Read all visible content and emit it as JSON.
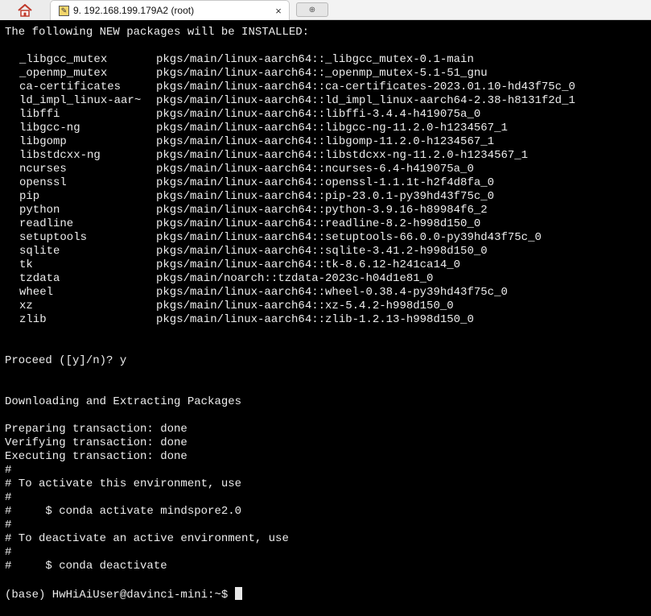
{
  "window": {
    "home_icon": "home-icon",
    "tab_icon": "terminal-icon",
    "tab_title": "9. 192.168.199.179A2 (root)",
    "tab_close": "×",
    "new_tab_symbol": "⊕"
  },
  "terminal": {
    "header": "The following NEW packages will be INSTALLED:",
    "packages": [
      {
        "name": "_libgcc_mutex",
        "source": "pkgs/main/linux-aarch64::_libgcc_mutex-0.1-main"
      },
      {
        "name": "_openmp_mutex",
        "source": "pkgs/main/linux-aarch64::_openmp_mutex-5.1-51_gnu"
      },
      {
        "name": "ca-certificates",
        "source": "pkgs/main/linux-aarch64::ca-certificates-2023.01.10-hd43f75c_0"
      },
      {
        "name": "ld_impl_linux-aar~",
        "source": "pkgs/main/linux-aarch64::ld_impl_linux-aarch64-2.38-h8131f2d_1"
      },
      {
        "name": "libffi",
        "source": "pkgs/main/linux-aarch64::libffi-3.4.4-h419075a_0"
      },
      {
        "name": "libgcc-ng",
        "source": "pkgs/main/linux-aarch64::libgcc-ng-11.2.0-h1234567_1"
      },
      {
        "name": "libgomp",
        "source": "pkgs/main/linux-aarch64::libgomp-11.2.0-h1234567_1"
      },
      {
        "name": "libstdcxx-ng",
        "source": "pkgs/main/linux-aarch64::libstdcxx-ng-11.2.0-h1234567_1"
      },
      {
        "name": "ncurses",
        "source": "pkgs/main/linux-aarch64::ncurses-6.4-h419075a_0"
      },
      {
        "name": "openssl",
        "source": "pkgs/main/linux-aarch64::openssl-1.1.1t-h2f4d8fa_0"
      },
      {
        "name": "pip",
        "source": "pkgs/main/linux-aarch64::pip-23.0.1-py39hd43f75c_0"
      },
      {
        "name": "python",
        "source": "pkgs/main/linux-aarch64::python-3.9.16-h89984f6_2"
      },
      {
        "name": "readline",
        "source": "pkgs/main/linux-aarch64::readline-8.2-h998d150_0"
      },
      {
        "name": "setuptools",
        "source": "pkgs/main/linux-aarch64::setuptools-66.0.0-py39hd43f75c_0"
      },
      {
        "name": "sqlite",
        "source": "pkgs/main/linux-aarch64::sqlite-3.41.2-h998d150_0"
      },
      {
        "name": "tk",
        "source": "pkgs/main/linux-aarch64::tk-8.6.12-h241ca14_0"
      },
      {
        "name": "tzdata",
        "source": "pkgs/main/noarch::tzdata-2023c-h04d1e81_0"
      },
      {
        "name": "wheel",
        "source": "pkgs/main/linux-aarch64::wheel-0.38.4-py39hd43f75c_0"
      },
      {
        "name": "xz",
        "source": "pkgs/main/linux-aarch64::xz-5.4.2-h998d150_0"
      },
      {
        "name": "zlib",
        "source": "pkgs/main/linux-aarch64::zlib-1.2.13-h998d150_0"
      }
    ],
    "proceed": "Proceed ([y]/n)? y",
    "downloading": "Downloading and Extracting Packages",
    "transaction": [
      "Preparing transaction: done",
      "Verifying transaction: done",
      "Executing transaction: done"
    ],
    "notes": [
      "#",
      "# To activate this environment, use",
      "#",
      "#     $ conda activate mindspore2.0",
      "#",
      "# To deactivate an active environment, use",
      "#",
      "#     $ conda deactivate"
    ],
    "prompt": "(base) HwHiAiUser@davinci-mini:~$ "
  }
}
